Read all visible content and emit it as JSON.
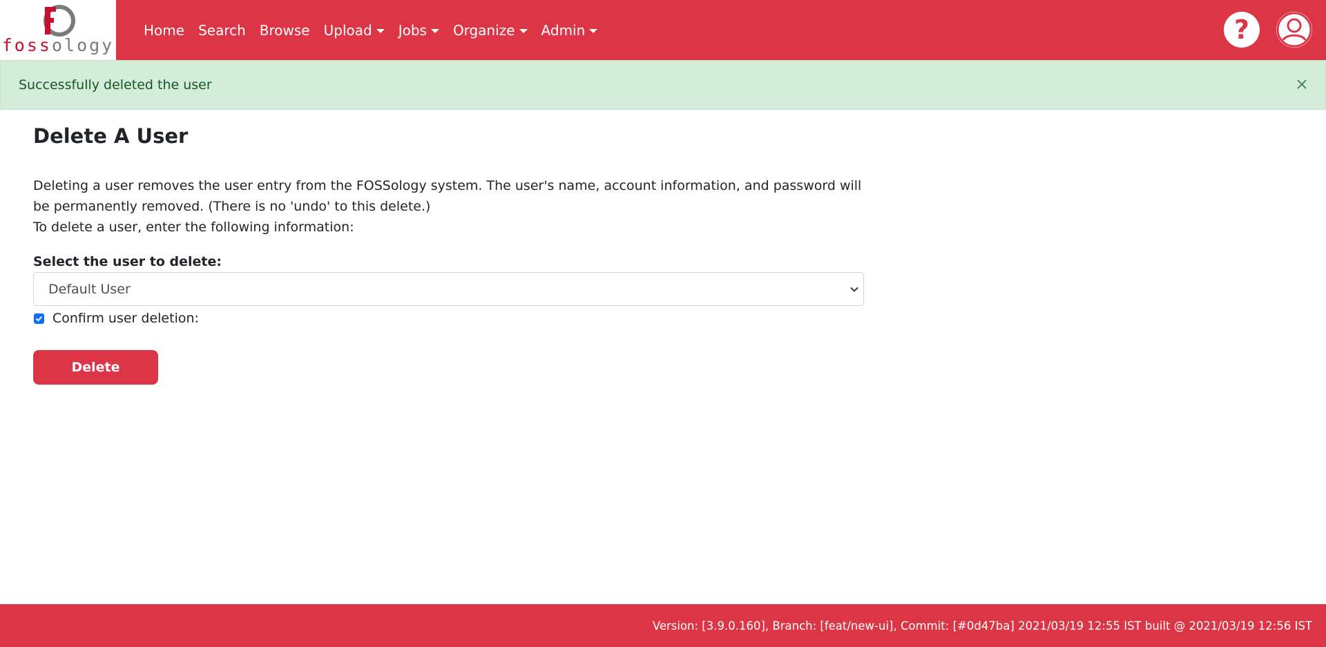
{
  "brand": {
    "logo_text_red": "foss",
    "logo_text_gray": "ology",
    "accent_color": "#dc3545"
  },
  "nav": {
    "items": [
      {
        "label": "Home",
        "dropdown": false
      },
      {
        "label": "Search",
        "dropdown": false
      },
      {
        "label": "Browse",
        "dropdown": false
      },
      {
        "label": "Upload",
        "dropdown": true
      },
      {
        "label": "Jobs",
        "dropdown": true
      },
      {
        "label": "Organize",
        "dropdown": true
      },
      {
        "label": "Admin",
        "dropdown": true
      }
    ],
    "help_icon": "question-mark-icon",
    "user_icon": "user-circle-icon",
    "help_glyph": "?"
  },
  "alert": {
    "message": "Successfully deleted the user",
    "close_icon": "close-icon"
  },
  "main": {
    "title": "Delete A User",
    "desc_line1": "Deleting a user removes the user entry from the FOSSology system. The user's name, account information, and password will be permanently removed. (There is no 'undo' to this delete.)",
    "desc_line2": "To delete a user, enter the following information:",
    "select_label": "Select the user to delete:",
    "select_value": "Default User",
    "confirm_label": "Confirm user deletion:",
    "confirm_checked": true,
    "delete_label": "Delete"
  },
  "footer": {
    "text": "Version: [3.9.0.160], Branch: [feat/new-ui], Commit: [#0d47ba] 2021/03/19 12:55 IST built @ 2021/03/19 12:56 IST"
  }
}
